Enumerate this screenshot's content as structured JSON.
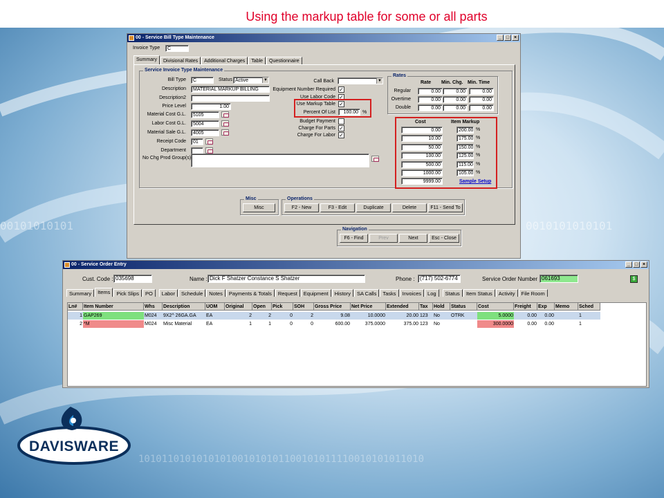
{
  "slide_title": "Using the markup table for some or all parts",
  "bill_window": {
    "title": "00 - Service Bill Type Maintenance",
    "invoice_type_label": "Invoice Type",
    "invoice_type_value": "C",
    "tabs": [
      "Summary",
      "Divisional Rates",
      "Additional Charges",
      "Table",
      "Questionnaire"
    ],
    "group_title": "Service Invoice Type Maintenance",
    "bill_type_label": "Bill Type",
    "bill_type_value": "C",
    "status_label": "Status",
    "status_value": "Active",
    "description_label": "Description",
    "description_value": "MATERIAL MARKUP BILLING",
    "description2_label": "Description2",
    "description2_value": "",
    "price_level_label": "Price Level",
    "price_level_value": "1.00",
    "material_cost_label": "Material Cost G.L.",
    "material_cost_value": "5105",
    "labor_cost_label": "Labor Cost G.L.",
    "labor_cost_value": "5004",
    "material_sale_label": "Material Sale G.L.",
    "material_sale_value": "4005",
    "receipt_code_label": "Receipt Code",
    "receipt_code_value": "01",
    "department_label": "Department",
    "department_value": "",
    "no_chg_label": "No Chg Prod Group(s)",
    "call_back_label": "Call Back",
    "equip_req_label": "Equipment Number Required",
    "use_labor_label": "Use Labor Code",
    "use_markup_label": "Use Markup Table",
    "percent_list_label": "Percent Of List",
    "percent_list_value": "100.00",
    "percent_symbol": "%",
    "budget_label": "Budget Payment",
    "charge_parts_label": "Charge For Parts",
    "charge_labor_label": "Charge For Labor",
    "checks": {
      "equip_req": true,
      "use_labor": true,
      "use_markup": true,
      "budget": false,
      "charge_parts": true,
      "charge_labor": true
    },
    "rates": {
      "title": "Rates",
      "col_rate": "Rate",
      "col_min_chg": "Min. Chg.",
      "col_min_time": "Min. Time",
      "rows": [
        {
          "label": "Regular",
          "rate": "0.00",
          "min_chg": "0.00",
          "min_time": "0.00"
        },
        {
          "label": "Overtime",
          "rate": "0.00",
          "min_chg": "0.00",
          "min_time": "0.00"
        },
        {
          "label": "Double",
          "rate": "0.00",
          "min_chg": "0.00",
          "min_time": "0.00"
        }
      ]
    },
    "markup": {
      "col_cost": "Cost",
      "col_markup": "Item Markup",
      "rows": [
        {
          "cost": "0.00",
          "markup": "200.00"
        },
        {
          "cost": "10.00",
          "markup": "175.00"
        },
        {
          "cost": "50.00",
          "markup": "150.00"
        },
        {
          "cost": "100.00",
          "markup": "125.00"
        },
        {
          "cost": "500.00",
          "markup": "115.00"
        },
        {
          "cost": "1000.00",
          "markup": "105.00"
        },
        {
          "cost": "9999.00",
          "markup": ""
        }
      ],
      "sample_setup": "Sample Setup"
    },
    "misc_group": "Misc",
    "misc_button": "Misc",
    "operations_group": "Operations",
    "op_buttons": [
      "F2 - New",
      "F3 - Edit",
      "Duplicate",
      "Delete",
      "F11 - Send To"
    ],
    "navigation_group": "Navigation",
    "nav_buttons": [
      "F6 - Find",
      "Prev",
      "Next",
      "Esc - Close"
    ]
  },
  "order_window": {
    "title": "00 - Service Order Entry",
    "cust_code_label": "Cust. Code :",
    "cust_code_value": "035698",
    "name_label": "Name :",
    "name_value": "Dick F Shatzer Constance S Shatzer",
    "phone_label": "Phone :",
    "phone_value": "(717) 502-6774",
    "order_num_label": "Service Order Number :",
    "order_num_value": "061693",
    "tabs": [
      "Summary",
      "Items",
      "Pick Slips",
      "PO",
      "Labor",
      "Schedule",
      "Notes",
      "Payments & Totals",
      "Request",
      "Equipment",
      "History",
      "SA Calls",
      "Tasks",
      "Invoices",
      "Log",
      "Status",
      "Item Status",
      "Activity",
      "File Room"
    ],
    "columns": [
      "Ln#",
      "Item Number",
      "Whs",
      "Description",
      "UOM",
      "Original",
      "Open",
      "Pick",
      "SOH",
      "Gross Price",
      "Net Price",
      "Extended",
      "Tax",
      "Hold",
      "Status",
      "Cost",
      "Freight",
      "Exp",
      "Memo",
      "Sched"
    ],
    "rows": [
      [
        "1",
        "GAP269",
        "M024",
        "9X2^ 26GA.GA",
        "EA",
        "2",
        "2",
        "0",
        "2",
        "9.08",
        "10.0000",
        "20.00",
        "123",
        "No",
        "OTRK",
        "5.0000",
        "0.00",
        "0.00",
        "",
        "1"
      ],
      [
        "2",
        "*M",
        "M024",
        "Misc Material",
        "EA",
        "1",
        "1",
        "0",
        "0",
        "600.00",
        "375.0000",
        "375.00",
        "123",
        "No",
        "",
        "300.0000",
        "0.00",
        "0.00",
        "",
        "1"
      ]
    ],
    "colors": {
      "row1_item_bg": "#7ee07e",
      "row1_cost_bg": "#7ee07e",
      "row2_item_bg": "#f08a8a",
      "row2_cost_bg": "#f08a8a",
      "selected_row_bg": "#c8d8ec"
    }
  },
  "logo": {
    "text": "DAVISWARE"
  },
  "colors": {
    "title_red": "#e0002a",
    "titlebar_navy": "#0a246a",
    "highlight_red": "#d42020",
    "logo_navy": "#0b2f5b"
  }
}
